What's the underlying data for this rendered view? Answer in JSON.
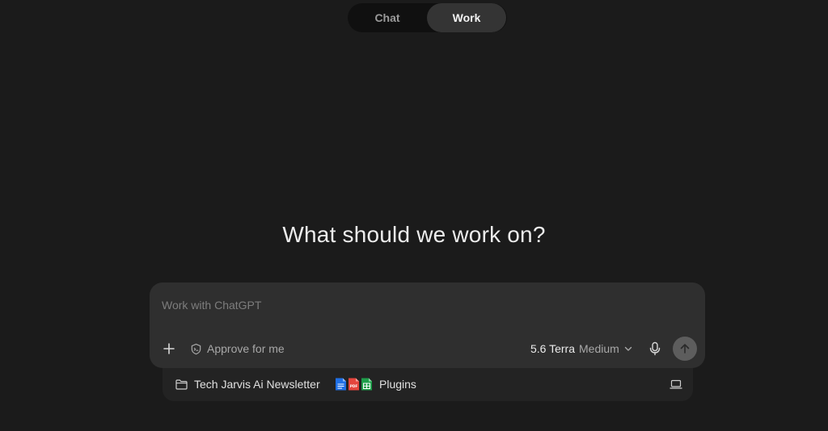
{
  "mode_toggle": {
    "tabs": [
      {
        "label": "Chat",
        "active": false
      },
      {
        "label": "Work",
        "active": true
      }
    ]
  },
  "main": {
    "heading": "What should we work on?"
  },
  "composer": {
    "placeholder": "Work with ChatGPT",
    "value": "",
    "add_icon": "plus-icon",
    "approve_label": "Approve for me",
    "approve_icon": "shield-icon",
    "model_name": "5.6 Terra",
    "model_effort": "Medium",
    "model_chevron_icon": "chevron-down-icon",
    "mic_icon": "microphone-icon",
    "send_icon": "arrow-up-icon"
  },
  "context_bar": {
    "folder_label": "Tech Jarvis Ai Newsletter",
    "folder_icon": "folder-icon",
    "plugins_label": "Plugins",
    "plugin_icons": [
      "docs-icon",
      "pdf-icon",
      "sheets-icon"
    ],
    "plugin_badge_text": "PDF",
    "device_icon": "laptop-icon"
  },
  "colors": {
    "background": "#1b1b1b",
    "composer": "#2f2f2f",
    "context_bar": "#232323",
    "toggle_track": "#101010",
    "toggle_active": "#343434",
    "send_button": "#5d5d5d",
    "docs_blue": "#1f6fe5",
    "pdf_red": "#e5453d",
    "sheets_green": "#1e9e4a"
  }
}
